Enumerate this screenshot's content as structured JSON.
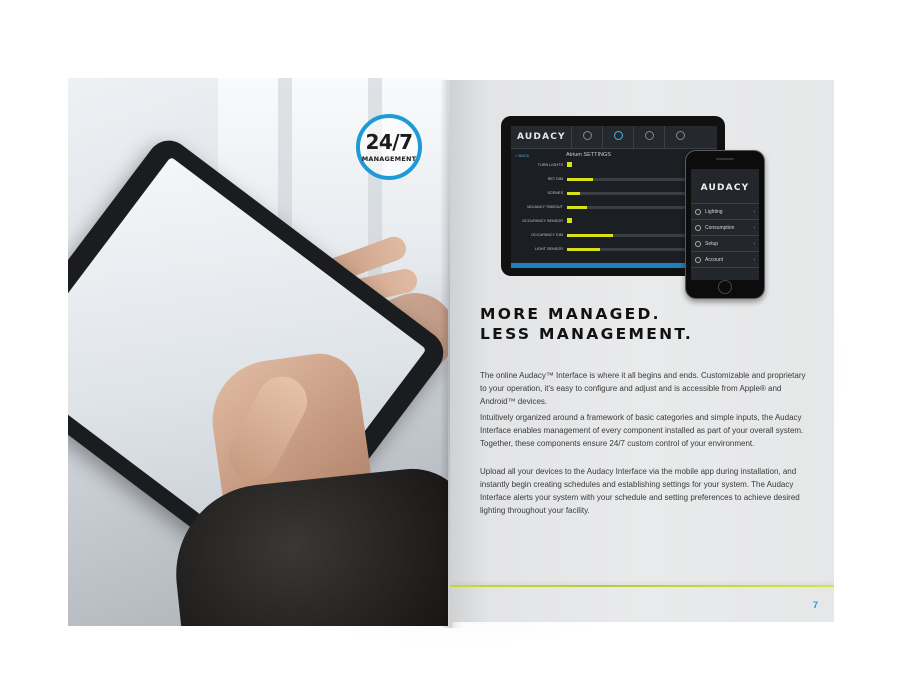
{
  "left_page": {
    "badge": {
      "number": "24/7",
      "label": "MANAGEMENT",
      "ring_color": "#1e9ad6"
    },
    "photo": "hands-holding-tablet-photo"
  },
  "right_page": {
    "tablet_mockup": {
      "logo": "AUDACY",
      "back_link": "< BACK",
      "screen_title": "Atrium SETTINGS",
      "rows": [
        {
          "label": "TURN LIGHTS",
          "kind": "check",
          "level": 0
        },
        {
          "label": "SET DIM",
          "kind": "slider",
          "level": 0.2
        },
        {
          "label": "SCENES",
          "kind": "slider",
          "level": 0.1
        },
        {
          "label": "VACANCY TIMEOUT",
          "kind": "slider",
          "level": 0.15
        },
        {
          "label": "OCCUPANCY SENSOR",
          "kind": "check",
          "level": 0
        },
        {
          "label": "OCCUPANCY DIM",
          "kind": "slider",
          "level": 0.35
        },
        {
          "label": "LIGHT SENSOR",
          "kind": "slider",
          "level": 0.25
        }
      ],
      "accent_color": "#d7e21d"
    },
    "phone_mockup": {
      "logo": "AUDACY",
      "menu": [
        "Lighting",
        "Consumption",
        "Setup",
        "Account"
      ]
    },
    "headline_line1": "MORE MANAGED.",
    "headline_line2": "LESS MANAGEMENT.",
    "paragraphs": [
      "The online Audacy™ Interface is where it all begins and ends. Customizable and proprietary to your operation, it's easy to configure and adjust and is accessible from Apple® and Android™ devices.",
      "Intuitively organized around a framework of basic categories and simple inputs, the Audacy Interface enables management of every component installed as part of your overall system. Together, these components ensure 24/7 custom control of your environment.",
      "Upload all your devices to the Audacy Interface via the mobile app during installation, and instantly begin creating schedules and establishing settings for your system. The Audacy Interface alerts your system with your schedule and setting preferences to achieve desired lighting throughout your facility."
    ],
    "page_number": "7",
    "rule_color": "#c8d82f"
  }
}
